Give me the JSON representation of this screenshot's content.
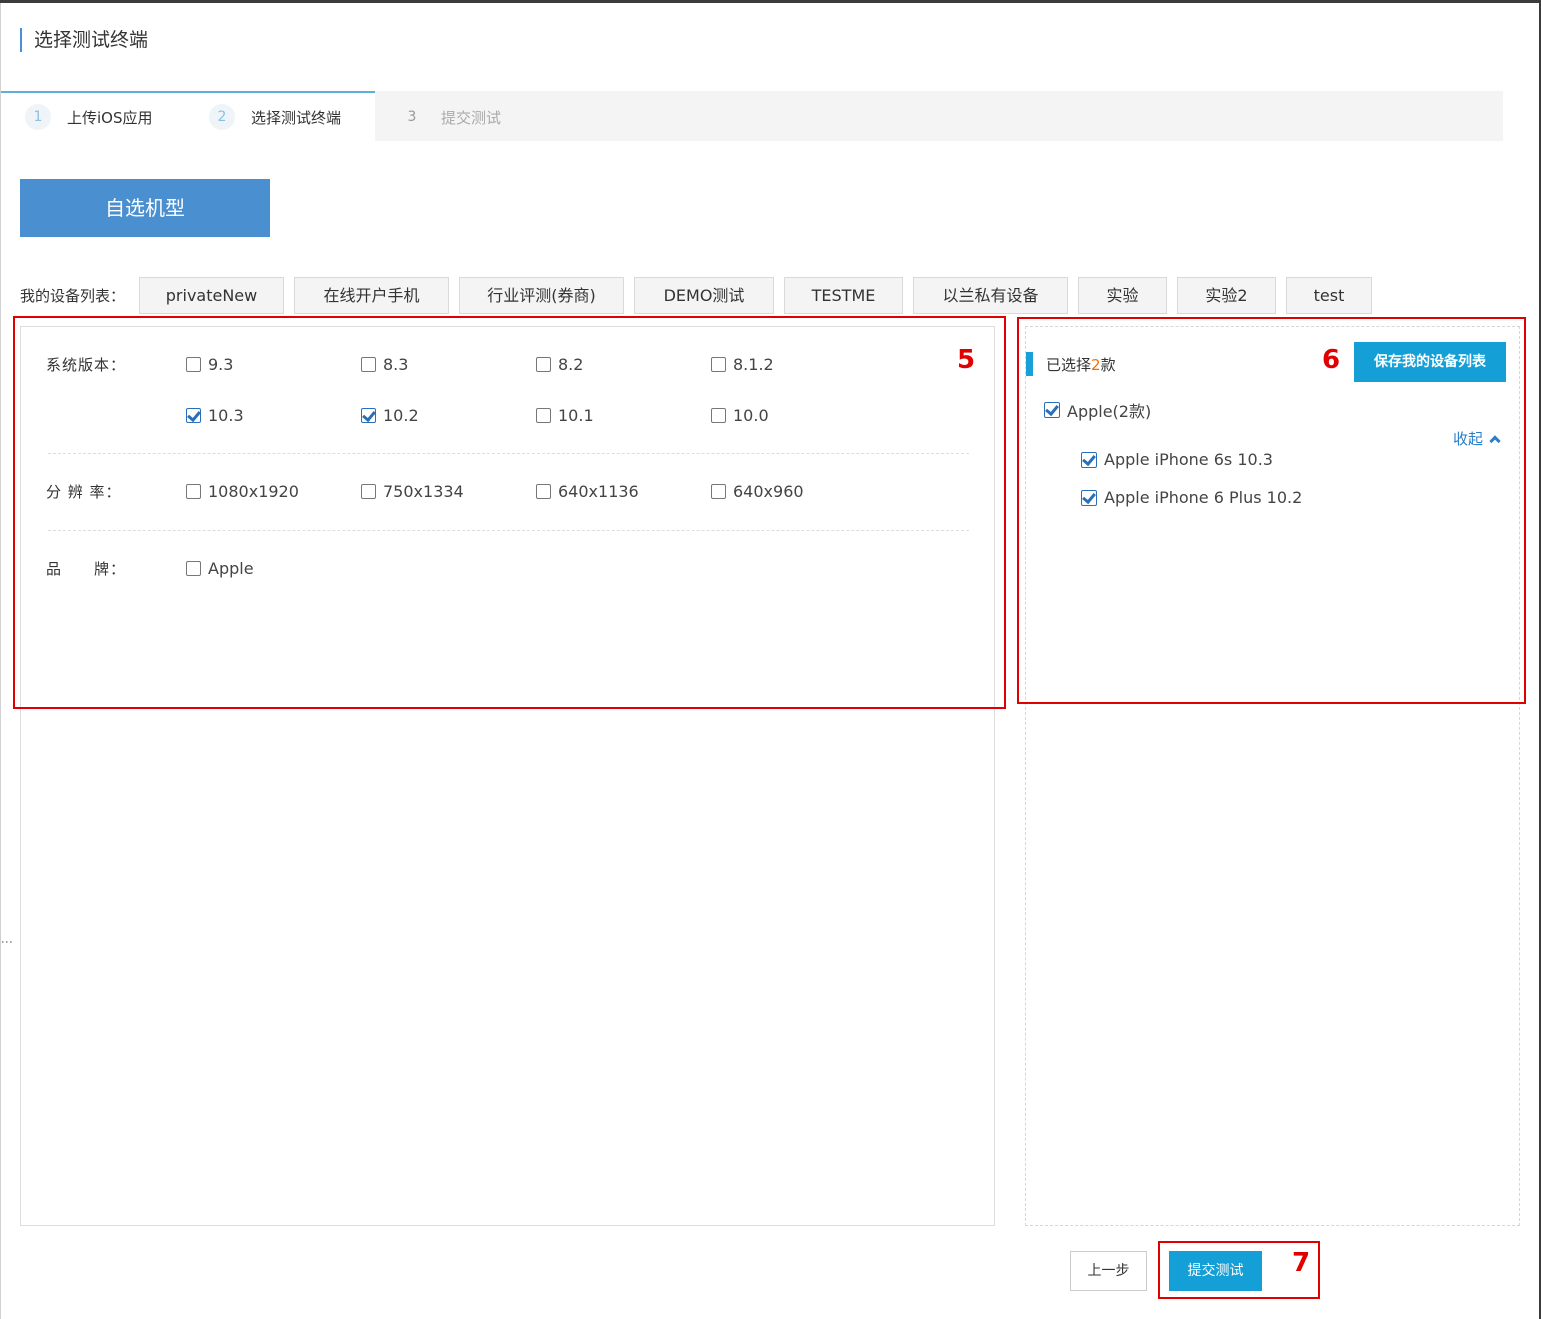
{
  "page_title": "选择测试终端",
  "steps": [
    {
      "num": "1",
      "label": "上传iOS应用"
    },
    {
      "num": "2",
      "label": "选择测试终端"
    },
    {
      "num": "3",
      "label": "提交测试"
    }
  ],
  "custom_model_button": "自选机型",
  "device_list": {
    "label": "我的设备列表：",
    "tabs": [
      "privateNew",
      "在线开户手机",
      "行业评测(券商)",
      "DEMO测试",
      "TESTME",
      "以兰私有设备",
      "实验",
      "实验2",
      "test"
    ]
  },
  "filters": {
    "os_label": "系统版本：",
    "os_options": [
      {
        "label": "9.3",
        "checked": false
      },
      {
        "label": "8.3",
        "checked": false
      },
      {
        "label": "8.2",
        "checked": false
      },
      {
        "label": "8.1.2",
        "checked": false
      },
      {
        "label": "10.3",
        "checked": true
      },
      {
        "label": "10.2",
        "checked": true
      },
      {
        "label": "10.1",
        "checked": false
      },
      {
        "label": "10.0",
        "checked": false
      }
    ],
    "resolution_label": "分 辨 率：",
    "resolution_options": [
      {
        "label": "1080x1920",
        "checked": false
      },
      {
        "label": "750x1334",
        "checked": false
      },
      {
        "label": "640x1136",
        "checked": false
      },
      {
        "label": "640x960",
        "checked": false
      }
    ],
    "brand_label": "品　　牌：",
    "brand_options": [
      {
        "label": "Apple",
        "checked": false
      }
    ]
  },
  "selection": {
    "prefix": "已选择",
    "count": "2",
    "suffix": "款",
    "save_button": "保存我的设备列表",
    "group_label": "Apple(2款)",
    "collapse_label": "收起",
    "items": [
      "Apple iPhone 6s 10.3",
      "Apple iPhone 6 Plus 10.2"
    ]
  },
  "footer": {
    "prev_button": "上一步",
    "submit_button": "提交测试"
  },
  "annotations": [
    "5",
    "6",
    "7"
  ],
  "colors": {
    "accent": "#149fd6",
    "custom_button": "#4a8fd0",
    "highlight_box": "#e00000",
    "count_color": "#ff6a00"
  }
}
